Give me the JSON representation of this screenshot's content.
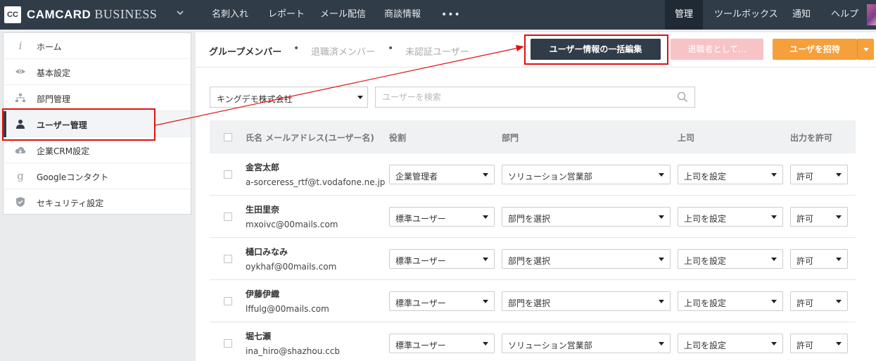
{
  "topbar": {
    "logo": "CC",
    "brand": "CAMCARD",
    "brand_sub": "BUSINESS",
    "nav_left": [
      "名刺入れ",
      "レポート",
      "メール配信",
      "商談情報"
    ],
    "more": "•••",
    "nav_right": [
      "管理",
      "ツールボックス",
      "通知",
      "ヘルプ"
    ],
    "active_nav": "管理"
  },
  "sidebar": {
    "items": [
      {
        "label": "ホーム",
        "icon": "info-icon"
      },
      {
        "label": "基本設定",
        "icon": "eye-icon"
      },
      {
        "label": "部門管理",
        "icon": "org-chart-icon"
      },
      {
        "label": "ユーザー管理",
        "icon": "user-icon",
        "active": true
      },
      {
        "label": "企業CRM設定",
        "icon": "cloud-icon"
      },
      {
        "label": "Googleコンタクト",
        "icon": "google-icon"
      },
      {
        "label": "セキュリティ設定",
        "icon": "shield-icon"
      }
    ]
  },
  "tabs": {
    "items": [
      "グループメンバー",
      "退職済メンバー",
      "未認証ユーザー"
    ],
    "active": "グループメンバー",
    "separator": "•"
  },
  "actions": {
    "bulk_edit": "ユーザー情報の一括編集",
    "retire": "退職者として...",
    "invite": "ユーザを招待"
  },
  "filters": {
    "org": "キングデモ株式会社",
    "search_placeholder": "ユーザーを検索"
  },
  "table": {
    "headers": {
      "name": "氏名 メールアドレス(ユーザー名)",
      "role": "役割",
      "dept": "部門",
      "boss": "上司",
      "output": "出力を許可"
    },
    "rows": [
      {
        "name": "金宮太郎",
        "email": "a-sorceress_rtf@t.vodafone.ne.jp",
        "role": "企業管理者",
        "dept": "ソリューション営業部",
        "boss": "上司を設定",
        "output": "許可"
      },
      {
        "name": "生田里奈",
        "email": "mxoivc@00mails.com",
        "role": "標準ユーザー",
        "dept": "部門を選択",
        "boss": "上司を設定",
        "output": "許可"
      },
      {
        "name": "樋口みなみ",
        "email": "oykhaf@00mails.com",
        "role": "標準ユーザー",
        "dept": "部門を選択",
        "boss": "上司を設定",
        "output": "許可"
      },
      {
        "name": "伊藤伊織",
        "email": "lffulg@00mails.com",
        "role": "標準ユーザー",
        "dept": "部門を選択",
        "boss": "上司を設定",
        "output": "許可"
      },
      {
        "name": "堀七瀬",
        "email": "ina_hiro@shazhou.ccb",
        "role": "標準ユーザー",
        "dept": "ソリューション営業部",
        "boss": "上司を設定",
        "output": "許可"
      }
    ]
  },
  "colors": {
    "topbar": "#303c48",
    "primary_button": "#303c48",
    "retire_button": "#f7c3c6",
    "invite_button": "#f5a03a",
    "annotation": "#e01010"
  }
}
